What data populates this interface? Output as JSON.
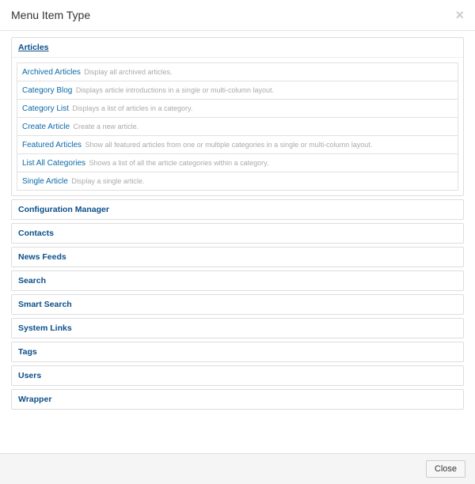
{
  "header": {
    "title": "Menu Item Type",
    "close_icon": "×"
  },
  "footer": {
    "close_label": "Close"
  },
  "accordion": [
    {
      "label": "Articles",
      "open": true,
      "types": [
        {
          "name": "Archived Articles",
          "desc": "Display all archived articles."
        },
        {
          "name": "Category Blog",
          "desc": "Displays article introductions in a single or multi-column layout."
        },
        {
          "name": "Category List",
          "desc": "Displays a list of articles in a category."
        },
        {
          "name": "Create Article",
          "desc": "Create a new article."
        },
        {
          "name": "Featured Articles",
          "desc": "Show all featured articles from one or multiple categories in a single or multi-column layout."
        },
        {
          "name": "List All Categories",
          "desc": "Shows a list of all the article categories within a category."
        },
        {
          "name": "Single Article",
          "desc": "Display a single article."
        }
      ]
    },
    {
      "label": "Configuration Manager",
      "open": false,
      "types": []
    },
    {
      "label": "Contacts",
      "open": false,
      "types": []
    },
    {
      "label": "News Feeds",
      "open": false,
      "types": []
    },
    {
      "label": "Search",
      "open": false,
      "types": []
    },
    {
      "label": "Smart Search",
      "open": false,
      "types": []
    },
    {
      "label": "System Links",
      "open": false,
      "types": []
    },
    {
      "label": "Tags",
      "open": false,
      "types": []
    },
    {
      "label": "Users",
      "open": false,
      "types": []
    },
    {
      "label": "Wrapper",
      "open": false,
      "types": []
    }
  ]
}
